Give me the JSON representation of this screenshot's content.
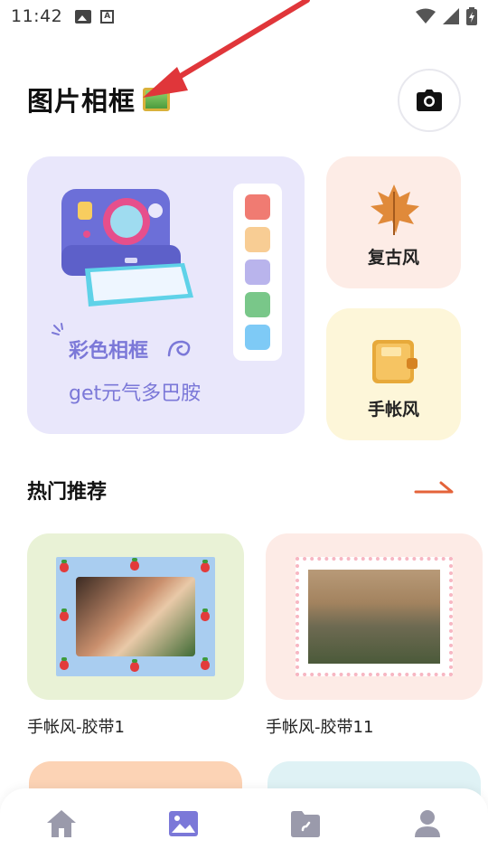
{
  "status_bar": {
    "time": "11:42",
    "icons": [
      "image-notification-icon",
      "a-notification-icon",
      "wifi-icon",
      "signal-icon",
      "battery-icon"
    ]
  },
  "header": {
    "title": "图片相框",
    "title_icon": "framed-picture-emoji",
    "camera_icon": "camera-icon"
  },
  "features": {
    "color_frame": {
      "title": "彩色相框",
      "subtitle": "get元气多巴胺",
      "swatches": [
        "#f07b72",
        "#f8cd94",
        "#b9b4ec",
        "#79c789",
        "#7ecaf6"
      ]
    },
    "retro": {
      "label": "复古风",
      "icon": "maple-leaf-icon"
    },
    "journal": {
      "label": "手帐风",
      "icon": "notebook-icon"
    }
  },
  "hot": {
    "title": "热门推荐",
    "more_icon": "arrow-right-icon",
    "items": [
      {
        "label": "手帐风-胶带1"
      },
      {
        "label": "手帐风-胶带11"
      }
    ]
  },
  "bottom_nav": {
    "items": [
      "home-icon",
      "gallery-icon",
      "folder-icon",
      "profile-icon"
    ],
    "active_index": 1,
    "active_color": "#7b78d8",
    "inactive_color": "#9a9aab"
  },
  "colors": {
    "accent": "#7b78d8",
    "annotation_arrow": "#e0363a"
  }
}
